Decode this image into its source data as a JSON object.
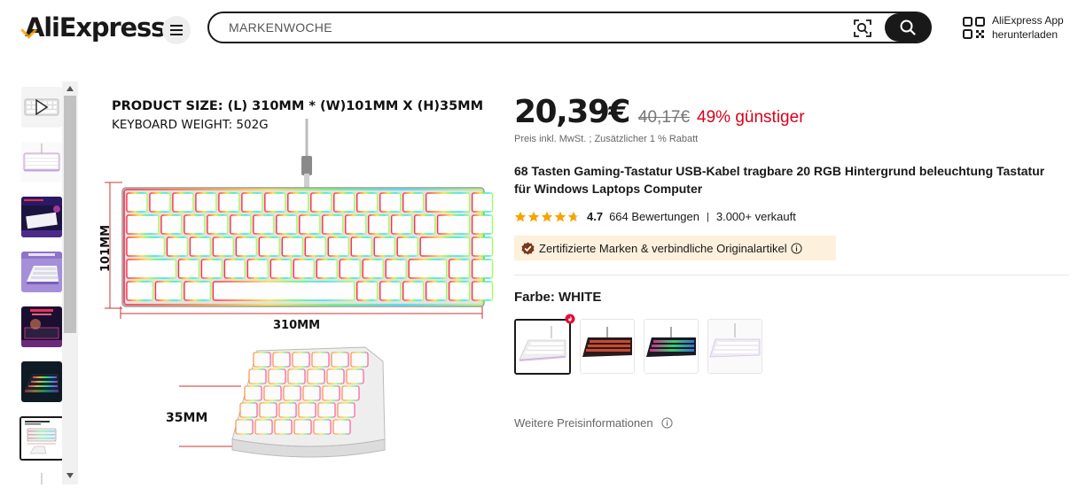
{
  "header": {
    "logo_text": "AliExpress",
    "search_placeholder": "MARKENWOCHE",
    "app_download_line1": "AliExpress App",
    "app_download_line2": "herunterladen"
  },
  "gallery": {
    "thumbnails": [
      {
        "label": "thumbnail-video"
      },
      {
        "label": "thumbnail-white-keyboard"
      },
      {
        "label": "thumbnail-lifestyle-1"
      },
      {
        "label": "thumbnail-purple-keyboard"
      },
      {
        "label": "thumbnail-lifestyle-2"
      },
      {
        "label": "thumbnail-rgb-keyboard"
      },
      {
        "label": "thumbnail-size-diagram"
      }
    ],
    "main_image": {
      "size_line": "PRODUCT SIZE: (L) 310MM * (W)101MM X (H)35MM",
      "weight_line": "KEYBOARD WEIGHT: 502G",
      "width_label": "310MM",
      "depth_label": "101MM",
      "height_label": "35MM"
    }
  },
  "product": {
    "price": "20,39€",
    "old_price": "40,17€",
    "discount": "49% günstiger",
    "tax_note": "Preis inkl. MwSt. ; Zusätzlicher 1 % Rabatt",
    "title": "68 Tasten Gaming-Tastatur USB-Kabel tragbare 20 RGB Hintergrund beleuchtung Tastatur für Windows Laptops Computer",
    "rating": "4.7",
    "rating_stars": 4.7,
    "reviews": "664 Bewertungen",
    "sold": "3.000+ verkauft",
    "certification": "Zertifizierte Marken & verbindliche Originalartikel",
    "color_label": "Farbe: WHITE",
    "more_price_info": "Weitere Preisinformationen"
  },
  "colors": {
    "accent_red": "#d3031c",
    "cert_bg": "#fdf0dc",
    "star": "#f7a300",
    "dark": "#191919"
  }
}
